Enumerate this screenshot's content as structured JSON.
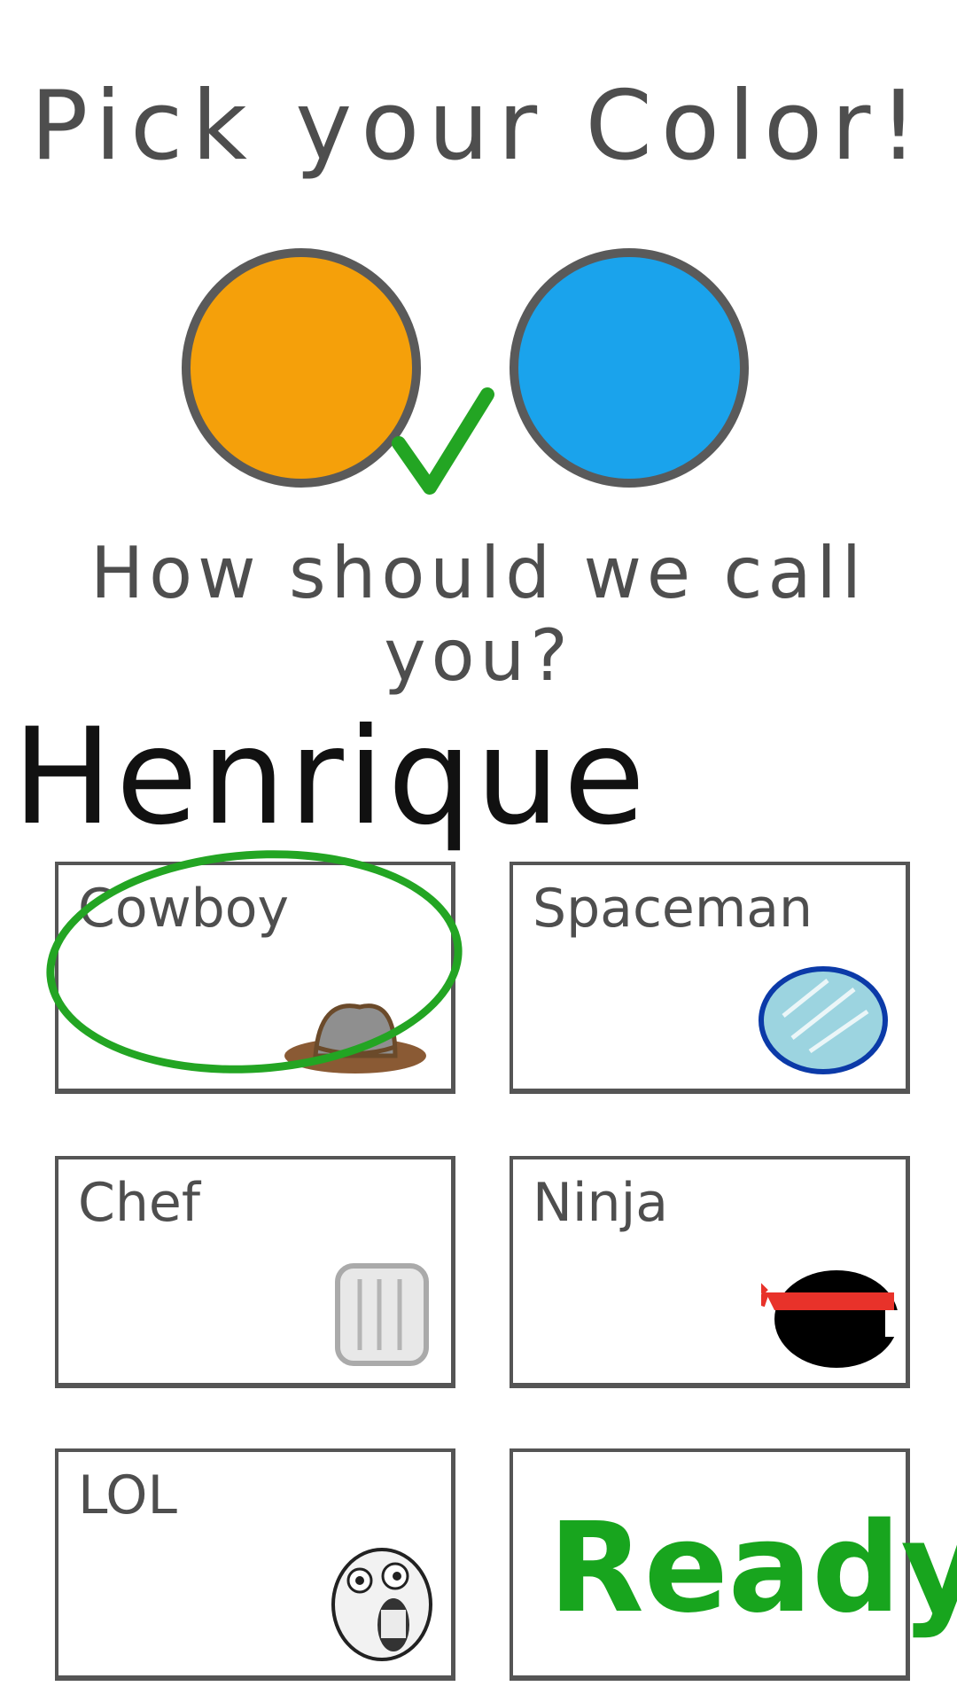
{
  "title": "Pick your Color!",
  "colors": [
    {
      "name": "orange-swatch",
      "hex": "#f5a00a",
      "selected": true
    },
    {
      "name": "blue-swatch",
      "hex": "#1aa3ec",
      "selected": false
    }
  ],
  "question": "How should we call you?",
  "player_name": "Henrique",
  "characters": [
    {
      "label": "Cowboy",
      "icon": "cowboy-hat-icon",
      "selected": true
    },
    {
      "label": "Spaceman",
      "icon": "space-helmet-icon",
      "selected": false
    },
    {
      "label": "Chef",
      "icon": "chef-hat-icon",
      "selected": false
    },
    {
      "label": "Ninja",
      "icon": "ninja-head-icon",
      "selected": false
    },
    {
      "label": "LOL",
      "icon": "lol-face-icon",
      "selected": false
    }
  ],
  "ready_label": "Ready",
  "accent_color": "#18a51e"
}
